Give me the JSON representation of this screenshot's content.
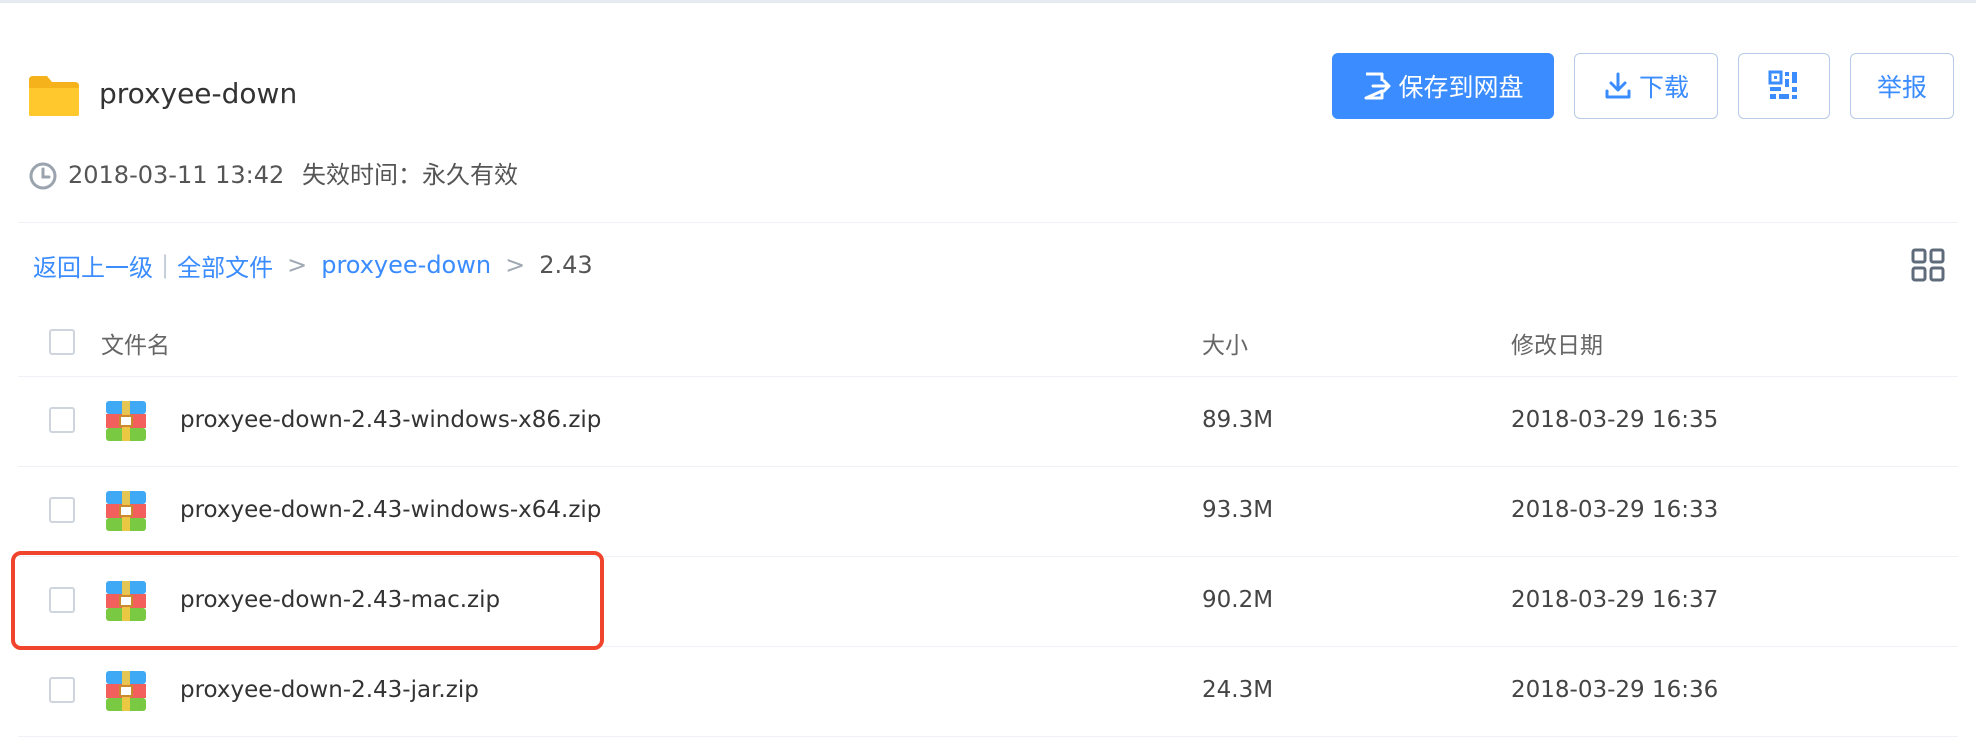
{
  "share": {
    "folder_name": "proxyee-down",
    "created": "2018-03-11 13:42",
    "expire_text": "失效时间：永久有效"
  },
  "actions": {
    "save_label": "保存到网盘",
    "download_label": "下载",
    "report_label": "举报"
  },
  "icons": {
    "folder": "folder-icon",
    "save": "save-to-cloud-icon",
    "download": "download-icon",
    "qr": "qr-code-icon",
    "clock": "clock-icon",
    "grid": "grid-view-icon",
    "zip": "zip-archive-icon"
  },
  "breadcrumb": {
    "back": "返回上一级",
    "separator": "|",
    "items": [
      "全部文件",
      "proxyee-down"
    ],
    "arrow": ">",
    "current": "2.43"
  },
  "table": {
    "columns": [
      "文件名",
      "大小",
      "修改日期"
    ],
    "rows": [
      {
        "name": "proxyee-down-2.43-windows-x86.zip",
        "size": "89.3M",
        "modified": "2018-03-29 16:35"
      },
      {
        "name": "proxyee-down-2.43-windows-x64.zip",
        "size": "93.3M",
        "modified": "2018-03-29 16:33"
      },
      {
        "name": "proxyee-down-2.43-mac.zip",
        "size": "90.2M",
        "modified": "2018-03-29 16:37"
      },
      {
        "name": "proxyee-down-2.43-jar.zip",
        "size": "24.3M",
        "modified": "2018-03-29 16:36"
      }
    ]
  },
  "colors": {
    "accent": "#3b8cff",
    "highlight_border": "#f0452c",
    "folder_yellow": "#ffc82c"
  }
}
